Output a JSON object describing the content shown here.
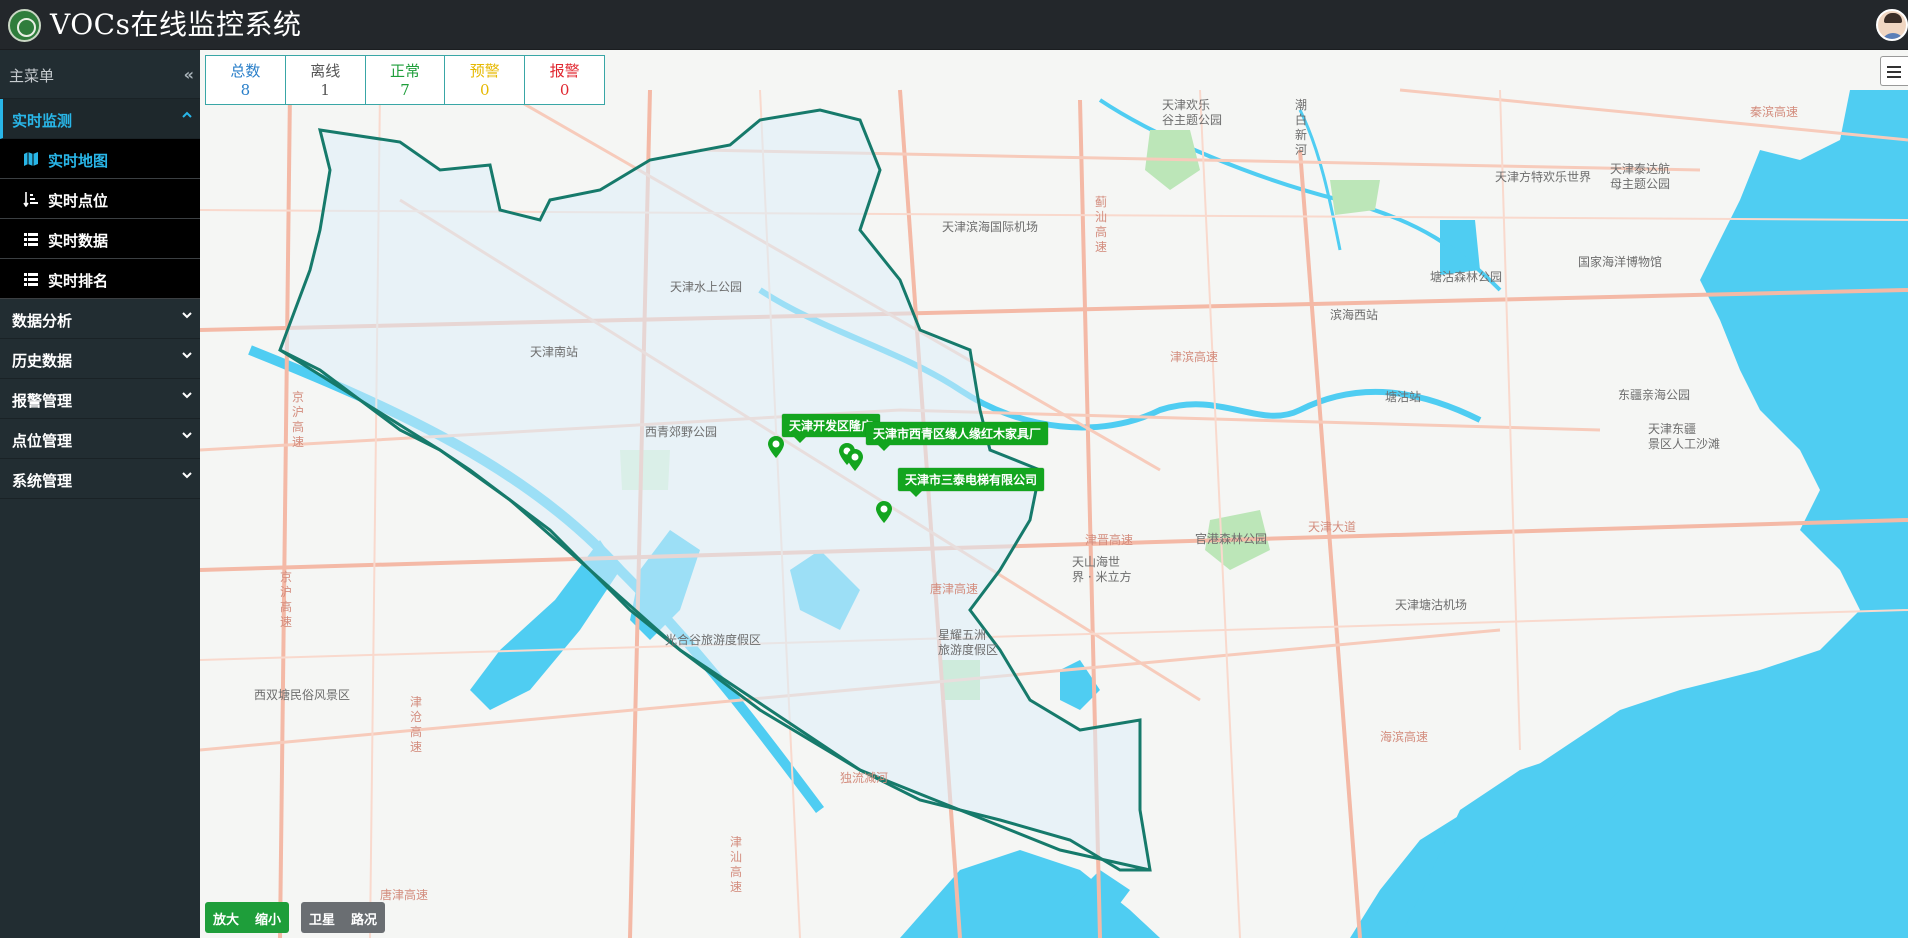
{
  "header": {
    "title": "VOCs在线监控系统"
  },
  "sidebar": {
    "menu_title": "主菜单",
    "groups": [
      {
        "label": "实时监测"
      },
      {
        "label": "数据分析"
      },
      {
        "label": "历史数据"
      },
      {
        "label": "报警管理"
      },
      {
        "label": "点位管理"
      },
      {
        "label": "系统管理"
      }
    ],
    "sub_items": [
      {
        "label": "实时地图",
        "icon": "map-icon"
      },
      {
        "label": "实时点位",
        "icon": "sort-icon"
      },
      {
        "label": "实时数据",
        "icon": "list-icon"
      },
      {
        "label": "实时排名",
        "icon": "list-icon"
      }
    ]
  },
  "stats": [
    {
      "label": "总数",
      "value": "8",
      "color": "#2a7fc9"
    },
    {
      "label": "离线",
      "value": "1",
      "color": "#555555"
    },
    {
      "label": "正常",
      "value": "7",
      "color": "#1e9e3a"
    },
    {
      "label": "预警",
      "value": "0",
      "color": "#e6b800"
    },
    {
      "label": "报警",
      "value": "0",
      "color": "#e0262f"
    }
  ],
  "markers": [
    {
      "label": "天津开发区隆广"
    },
    {
      "label": "天津市西青区缘人缘红木家具厂"
    },
    {
      "label": "天津市三泰电梯有限公司"
    }
  ],
  "map_labels": {
    "l1": "天津欢乐\n谷主题公园",
    "l2": "潮\n白\n新\n河",
    "l3": "天津方特欢乐世界",
    "l4": "天津泰达航\n母主题公园",
    "l5": "天津滨海国际机场",
    "l6": "国家海洋博物馆",
    "l7": "塘沽森林公园",
    "l8": "滨海西站",
    "l9": "天津水上公园",
    "l10": "天津南站",
    "l11": "西青郊野公园",
    "l12": "东疆亲海公园",
    "l13": "塘沽站",
    "l14": "天津东疆\n景区人工沙滩",
    "l15": "官港森林公园",
    "l16": "天山海世\n界 · 米立方",
    "l17": "国家海洋博物馆",
    "l18": "光合谷旅游度假区",
    "l19": "星耀五洲\n旅游度假区",
    "l20": "天津塘沽机场",
    "l21": "西双塘民俗风景区",
    "l22": "京\n沪\n高\n速",
    "l23": "京\n沪\n高\n速",
    "l24": "津\n沧\n高\n速",
    "l25": "津\n汕\n高\n速",
    "l26": "蓟\n汕\n高\n速",
    "l27": "津滨高速",
    "l28": "津晋高速",
    "l29": "唐津高速",
    "l30": "天津大道",
    "l31": "独流减河",
    "l32": "唐津高速",
    "l33": "秦滨高速",
    "l34": "海滨高速"
  },
  "controls": {
    "zoom_in": "放大",
    "zoom_out": "缩小",
    "satellite": "卫星",
    "traffic": "路况"
  }
}
